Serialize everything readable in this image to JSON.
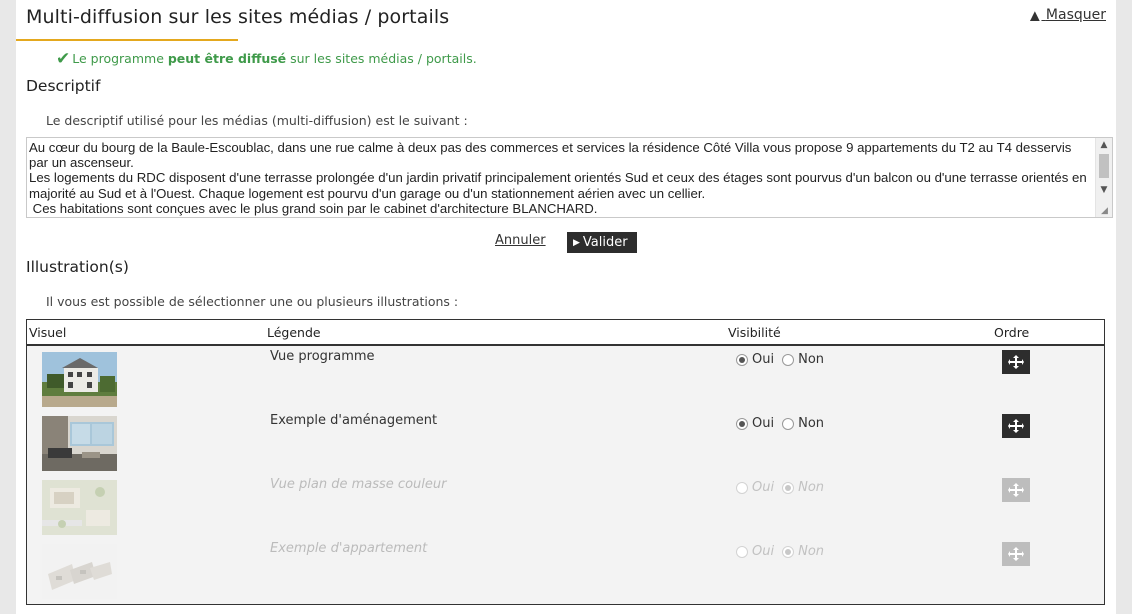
{
  "header": {
    "title": "Multi-diffusion sur les sites médias / portails",
    "hide_link": "Masquer",
    "hide_icon": "triangle-up-icon"
  },
  "status": {
    "prefix": "Le programme ",
    "emphasis": "peut être diffusé",
    "suffix": " sur les sites médias / portails.",
    "color": "#3f9a4a"
  },
  "descriptif": {
    "title": "Descriptif",
    "intro": "Le descriptif utilisé pour les médias (multi-diffusion) est le suivant :",
    "text": "Au cœur du bourg de la Baule-Escoublac, dans une rue calme à deux pas des commerces et services la résidence Côté Villa vous propose 9 appartements du T2 au T4 desservis par un ascenseur.\nLes logements du RDC disposent d'une terrasse prolongée d'un jardin privatif principalement orientés Sud et ceux des étages sont pourvus d'un balcon ou d'une terrasse orientés en majorité au Sud et à l'Ouest. Chaque logement est pourvu d'un garage ou d'un stationnement aérien avec un cellier.\n Ces habitations sont conçues avec le plus grand soin par le cabinet d'architecture BLANCHARD.",
    "cancel_label": "Annuler",
    "validate_label": "Valider"
  },
  "illustrations": {
    "title": "Illustration(s)",
    "intro": "Il vous est possible de sélectionner une ou plusieurs illustrations :",
    "columns": [
      "Visuel",
      "Légende",
      "Visibilité",
      "Ordre"
    ],
    "yes_label": "Oui",
    "no_label": "Non",
    "rows": [
      {
        "legend": "Vue programme",
        "visible": "Oui",
        "enabled": true,
        "thumb": "building-exterior"
      },
      {
        "legend": "Exemple d'aménagement",
        "visible": "Oui",
        "enabled": true,
        "thumb": "interior-living-room"
      },
      {
        "legend": "Vue plan de masse couleur",
        "visible": "Non",
        "enabled": false,
        "thumb": "site-plan"
      },
      {
        "legend": "Exemple d'appartement",
        "visible": "Non",
        "enabled": false,
        "thumb": "apartment-plan"
      }
    ]
  }
}
